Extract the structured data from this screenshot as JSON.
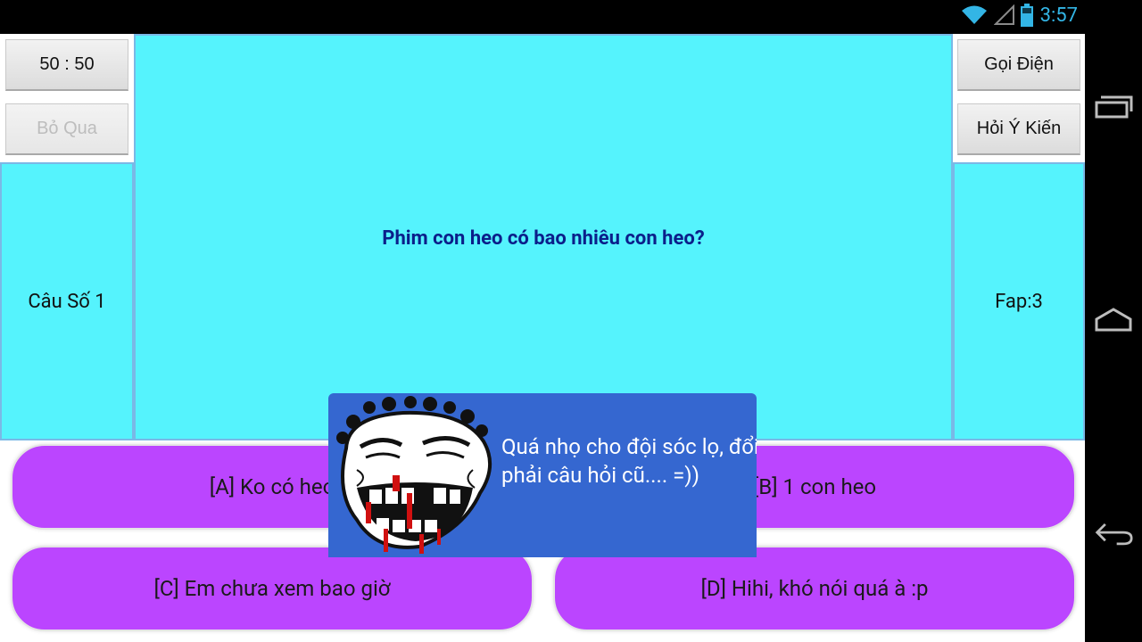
{
  "status_bar": {
    "time": "3:57",
    "icons": [
      "wifi-icon",
      "signal-icon",
      "battery-icon"
    ]
  },
  "lifelines": {
    "fifty_fifty": "50 : 50",
    "skip": "Bỏ Qua",
    "phone": "Gọi Điện",
    "ask": "Hỏi Ý Kiến"
  },
  "question": {
    "number_label": "Câu Số 1",
    "text": "Phim con heo có bao nhiêu con heo?",
    "score_label": "Fap:3"
  },
  "answers": [
    {
      "label": "[A] Ko có heo"
    },
    {
      "label": "[B] 1 con heo"
    },
    {
      "label": "[C] Em chưa xem bao giờ"
    },
    {
      "label": "[D] Hihi, khó nói quá à :p"
    }
  ],
  "toast": {
    "message": "Quá nhọ cho đội sóc lọ, đổi phải câu hỏi cũ.... =))",
    "image": "troll-face-icon"
  },
  "nav_bar": {
    "buttons": [
      "recent-apps-icon",
      "home-icon",
      "back-icon"
    ]
  },
  "colors": {
    "panel": "#55f3fd",
    "answer": "#bb45ff",
    "question_text": "#0b1f8a",
    "toast_bg": "#3567d0",
    "clock": "#33b5e5"
  }
}
